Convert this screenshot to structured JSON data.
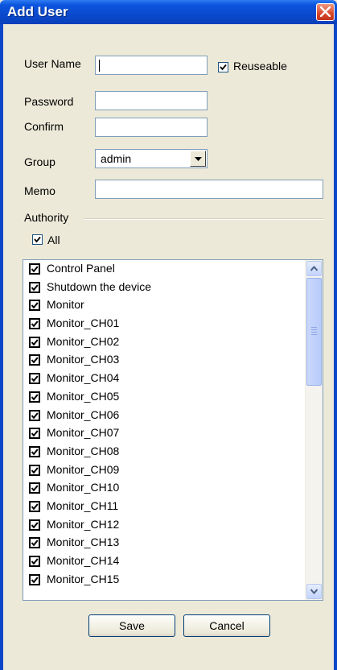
{
  "window": {
    "title": "Add User"
  },
  "form": {
    "user_name_label": "User Name",
    "user_name_value": "",
    "reuseable_label": "Reuseable",
    "reuseable_checked": true,
    "password_label": "Password",
    "confirm_label": "Confirm",
    "group_label": "Group",
    "group_value": "admin",
    "memo_label": "Memo",
    "authority_label": "Authority",
    "all_label": "All",
    "all_checked": true
  },
  "authority_list": [
    {
      "label": "Control Panel",
      "checked": true
    },
    {
      "label": "Shutdown the device",
      "checked": true
    },
    {
      "label": "Monitor",
      "checked": true
    },
    {
      "label": "Monitor_CH01",
      "checked": true
    },
    {
      "label": "Monitor_CH02",
      "checked": true
    },
    {
      "label": "Monitor_CH03",
      "checked": true
    },
    {
      "label": "Monitor_CH04",
      "checked": true
    },
    {
      "label": "Monitor_CH05",
      "checked": true
    },
    {
      "label": "Monitor_CH06",
      "checked": true
    },
    {
      "label": "Monitor_CH07",
      "checked": true
    },
    {
      "label": "Monitor_CH08",
      "checked": true
    },
    {
      "label": "Monitor_CH09",
      "checked": true
    },
    {
      "label": "Monitor_CH10",
      "checked": true
    },
    {
      "label": "Monitor_CH11",
      "checked": true
    },
    {
      "label": "Monitor_CH12",
      "checked": true
    },
    {
      "label": "Monitor_CH13",
      "checked": true
    },
    {
      "label": "Monitor_CH14",
      "checked": true
    },
    {
      "label": "Monitor_CH15",
      "checked": true
    }
  ],
  "buttons": {
    "save_label": "Save",
    "cancel_label": "Cancel"
  },
  "colors": {
    "titlebar": "#0a47c9",
    "dialog_bg": "#ece9d8",
    "input_border": "#7f9db9",
    "close_button": "#d9472b"
  }
}
